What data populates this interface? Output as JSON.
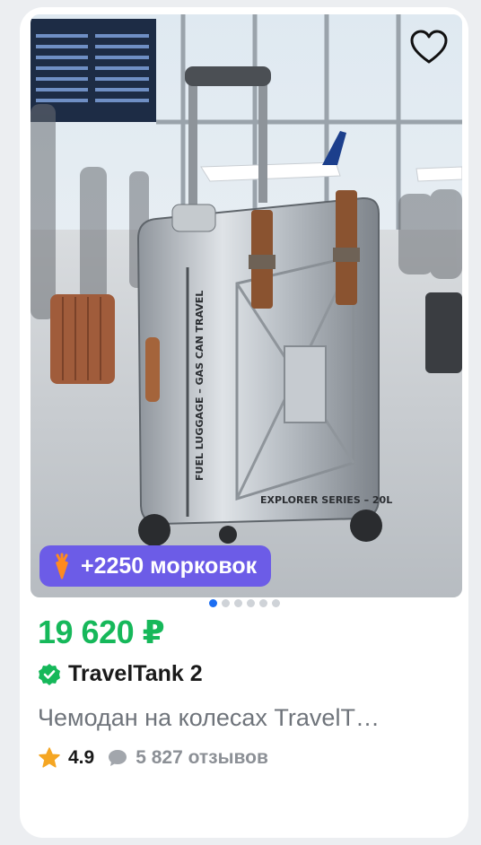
{
  "product": {
    "price": "19 620 ₽",
    "brand": "TravelTank 2",
    "title": "Чемодан на колесах TravelT…",
    "rating": "4.9",
    "reviews": "5 827 отзывов",
    "bonus": "+2250 морковок",
    "image_text": {
      "side_label": "FUEL LUGGAGE – GAS CAN TRAVEL",
      "series_label": "EXPLORER SERIES – 20L"
    }
  },
  "gallery": {
    "total_images": 6,
    "active_index": 0
  },
  "colors": {
    "price": "#16b85a",
    "bonus_bg": "#6c5ce7",
    "dot_active": "#1c6ef2",
    "verified": "#16b85a",
    "star": "#f5a623"
  },
  "icons": [
    "heart-icon",
    "carrot-icon",
    "verified-icon",
    "star-icon",
    "comment-icon"
  ]
}
